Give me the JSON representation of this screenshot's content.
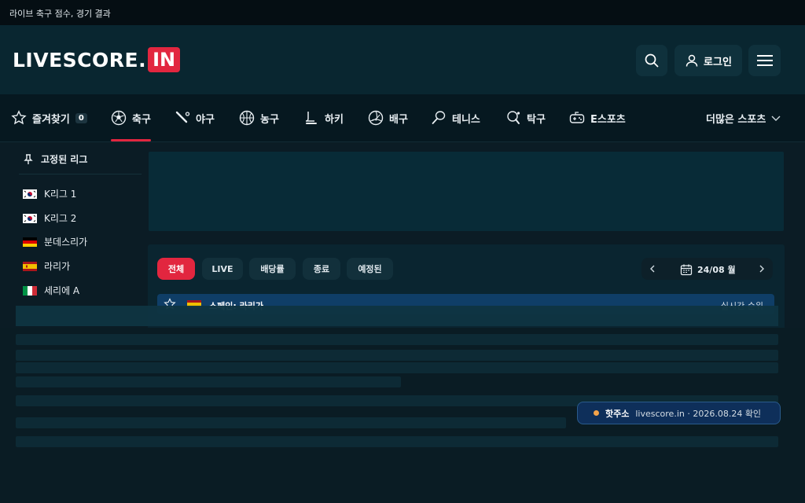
{
  "top_strip": {
    "text": "라이브 축구 점수, 경기 결과"
  },
  "header": {
    "logo_text": "LIVESCORE.",
    "logo_badge": "IN",
    "login_label": "로그인"
  },
  "nav": {
    "favorites_label": "즐겨찾기",
    "favorites_count": "0",
    "items": [
      {
        "label": "축구",
        "icon": "soccer-ball-icon"
      },
      {
        "label": "야구",
        "icon": "baseball-bat-icon"
      },
      {
        "label": "농구",
        "icon": "basketball-icon"
      },
      {
        "label": "하키",
        "icon": "hockey-stick-icon"
      },
      {
        "label": "배구",
        "icon": "volleyball-icon"
      },
      {
        "label": "테니스",
        "icon": "tennis-racket-icon"
      },
      {
        "label": "탁구",
        "icon": "table-tennis-icon"
      },
      {
        "label": "E스포츠",
        "icon": "gamepad-icon"
      }
    ],
    "more_label": "더많은 스포츠"
  },
  "sidebar": {
    "title": "고정된 리그",
    "leagues": [
      {
        "name": "K리그 1",
        "flag": "korea"
      },
      {
        "name": "K리그 2",
        "flag": "korea"
      },
      {
        "name": "분데스리가",
        "flag": "germany"
      },
      {
        "name": "라리가",
        "flag": "spain"
      },
      {
        "name": "세리에 A",
        "flag": "italy"
      }
    ]
  },
  "filters": {
    "all": "전체",
    "live": "LIVE",
    "odds": "배당률",
    "finished": "종료",
    "scheduled": "예정된"
  },
  "date": {
    "label": "24/08 월"
  },
  "league_row": {
    "name": "스페인: 라리가",
    "right": "실시간 순위"
  },
  "toast": {
    "hot": "핫주소",
    "message": "livescore.in · 2026.08.24 확인"
  },
  "colors": {
    "accent": "#e2263f",
    "background": "#0b1c25",
    "header": "#092630"
  }
}
